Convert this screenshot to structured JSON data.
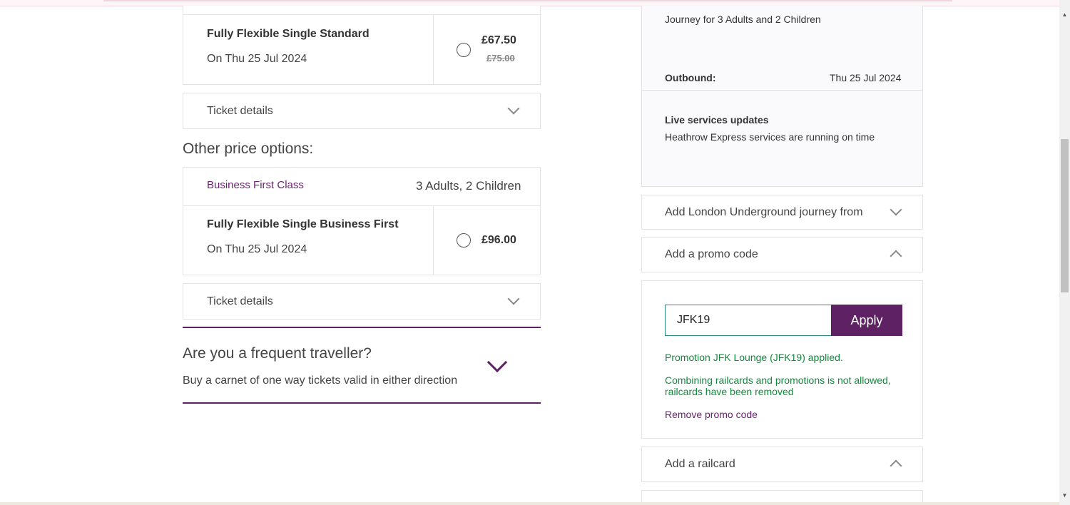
{
  "standard": {
    "name": "Fully Flexible Single Standard",
    "date": "On Thu 25 Jul 2024",
    "price": "£67.50",
    "old_price": "£75.00",
    "details_label": "Ticket details"
  },
  "other_options": {
    "title": "Other price options:",
    "class_name": "Business First Class",
    "passengers": "3 Adults, 2 Children",
    "ticket": {
      "name": "Fully Flexible Single Business First",
      "date": "On Thu 25 Jul 2024",
      "price": "£96.00",
      "details_label": "Ticket details"
    }
  },
  "frequent": {
    "title": "Are you a frequent traveller?",
    "subtitle": "Buy a carnet of one way tickets valid in either direction"
  },
  "summary": {
    "journey_for": "Journey for 3 Adults and 2 Children",
    "outbound_label": "Outbound:",
    "outbound_date": "Thu 25 Jul 2024",
    "live_title": "Live services updates",
    "live_text": "Heathrow Express services are running on time"
  },
  "accordions": {
    "underground": "Add London Underground journey from",
    "promo": "Add a promo code",
    "railcard": "Add a railcard"
  },
  "promo": {
    "value": "JFK19",
    "apply_label": "Apply",
    "applied_msg": "Promotion JFK Lounge (JFK19) applied.",
    "warning_line1": "Combining railcards and promotions is not allowed,",
    "warning_line2": "railcards have been removed",
    "remove_label": "Remove promo code"
  },
  "colors": {
    "brand_purple": "#5e2164",
    "success_green": "#118a3c",
    "input_border": "#2a8a82"
  }
}
